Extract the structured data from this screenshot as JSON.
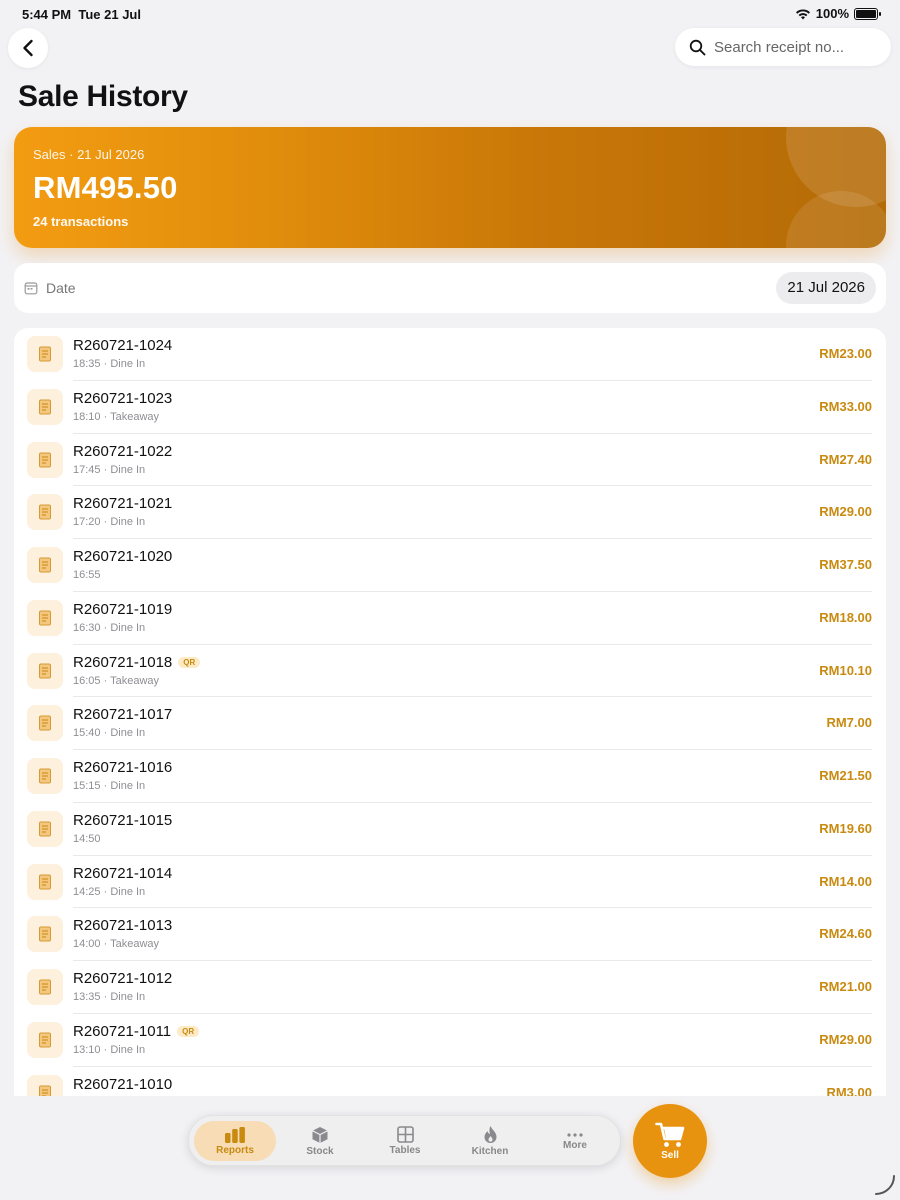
{
  "status_bar": {
    "time": "5:44 PM",
    "date": "Tue 21 Jul",
    "battery": "100%",
    "battery_level": 1.0
  },
  "search": {
    "placeholder": "Search receipt no..."
  },
  "page_title": "Sale History",
  "summary": {
    "label": "Sales · 21 Jul 2026",
    "amount": "RM495.50",
    "count": "24 transactions",
    "accent_color": "#f39c12"
  },
  "date_filter": {
    "label": "Date",
    "value": "21 Jul 2026"
  },
  "sales": [
    {
      "receipt": "R260721-1024",
      "time": "18:35",
      "type": "Dine In",
      "amount": "RM23.00",
      "qr": false
    },
    {
      "receipt": "R260721-1023",
      "time": "18:10",
      "type": "Takeaway",
      "amount": "RM33.00",
      "qr": false
    },
    {
      "receipt": "R260721-1022",
      "time": "17:45",
      "type": "Dine In",
      "amount": "RM27.40",
      "qr": false
    },
    {
      "receipt": "R260721-1021",
      "time": "17:20",
      "type": "Dine In",
      "amount": "RM29.00",
      "qr": false
    },
    {
      "receipt": "R260721-1020",
      "time": "16:55",
      "type": "",
      "amount": "RM37.50",
      "qr": false
    },
    {
      "receipt": "R260721-1019",
      "time": "16:30",
      "type": "Dine In",
      "amount": "RM18.00",
      "qr": false
    },
    {
      "receipt": "R260721-1018",
      "time": "16:05",
      "type": "Takeaway",
      "amount": "RM10.10",
      "qr": true
    },
    {
      "receipt": "R260721-1017",
      "time": "15:40",
      "type": "Dine In",
      "amount": "RM7.00",
      "qr": false
    },
    {
      "receipt": "R260721-1016",
      "time": "15:15",
      "type": "Dine In",
      "amount": "RM21.50",
      "qr": false
    },
    {
      "receipt": "R260721-1015",
      "time": "14:50",
      "type": "",
      "amount": "RM19.60",
      "qr": false
    },
    {
      "receipt": "R260721-1014",
      "time": "14:25",
      "type": "Dine In",
      "amount": "RM14.00",
      "qr": false
    },
    {
      "receipt": "R260721-1013",
      "time": "14:00",
      "type": "Takeaway",
      "amount": "RM24.60",
      "qr": false
    },
    {
      "receipt": "R260721-1012",
      "time": "13:35",
      "type": "Dine In",
      "amount": "RM21.00",
      "qr": false
    },
    {
      "receipt": "R260721-1011",
      "time": "13:10",
      "type": "Dine In",
      "amount": "RM29.00",
      "qr": true
    },
    {
      "receipt": "R260721-1010",
      "time": "",
      "type": "",
      "amount": "RM3.00",
      "qr": false
    }
  ],
  "qr_label": "QR",
  "meta_separator": " · ",
  "tabs": [
    {
      "label": "Reports",
      "icon": "bar-chart-icon",
      "active": true
    },
    {
      "label": "Stock",
      "icon": "box-icon",
      "active": false
    },
    {
      "label": "Tables",
      "icon": "grid-icon",
      "active": false
    },
    {
      "label": "Kitchen",
      "icon": "flame-icon",
      "active": false
    },
    {
      "label": "More",
      "icon": "ellipsis-icon",
      "active": false
    }
  ],
  "sell": {
    "label": "Sell",
    "icon": "cart-icon"
  },
  "colors": {
    "accent": "#e8930f",
    "amount": "#c98a10",
    "background": "#f2f2f5"
  }
}
